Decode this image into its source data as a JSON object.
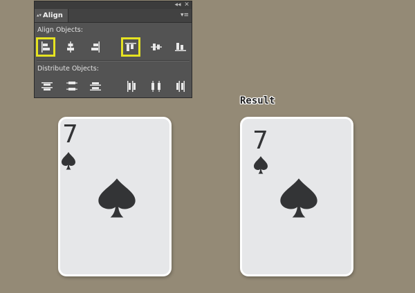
{
  "panel": {
    "tab_title": "Align",
    "tab_arrows": "▴▾",
    "collapse_glyph": "◂◂",
    "close_glyph": "✕",
    "menu_glyph": "▾≡",
    "align_section_label": "Align Objects:",
    "distribute_section_label": "Distribute Objects:",
    "align_buttons": [
      {
        "icon": "horizontal-align-left-icon",
        "highlighted": true
      },
      {
        "icon": "horizontal-align-center-icon",
        "highlighted": false
      },
      {
        "icon": "horizontal-align-right-icon",
        "highlighted": false
      },
      {
        "icon": "vertical-align-top-icon",
        "highlighted": true
      },
      {
        "icon": "vertical-align-center-icon",
        "highlighted": false
      },
      {
        "icon": "vertical-align-bottom-icon",
        "highlighted": false
      }
    ],
    "distribute_buttons": [
      {
        "icon": "vertical-distribute-top-icon"
      },
      {
        "icon": "vertical-distribute-center-icon"
      },
      {
        "icon": "vertical-distribute-bottom-icon"
      },
      {
        "icon": "horizontal-distribute-left-icon"
      },
      {
        "icon": "horizontal-distribute-center-icon"
      },
      {
        "icon": "horizontal-distribute-right-icon"
      }
    ],
    "highlight_color": "#e6e321"
  },
  "result_label": "Result",
  "cards": {
    "before": {
      "rank": "7",
      "suit": "spade"
    },
    "after": {
      "rank": "7",
      "suit": "spade"
    }
  },
  "colors": {
    "background": "#948a76",
    "card_face": "#e6e7e9",
    "card_ink": "#333436"
  }
}
